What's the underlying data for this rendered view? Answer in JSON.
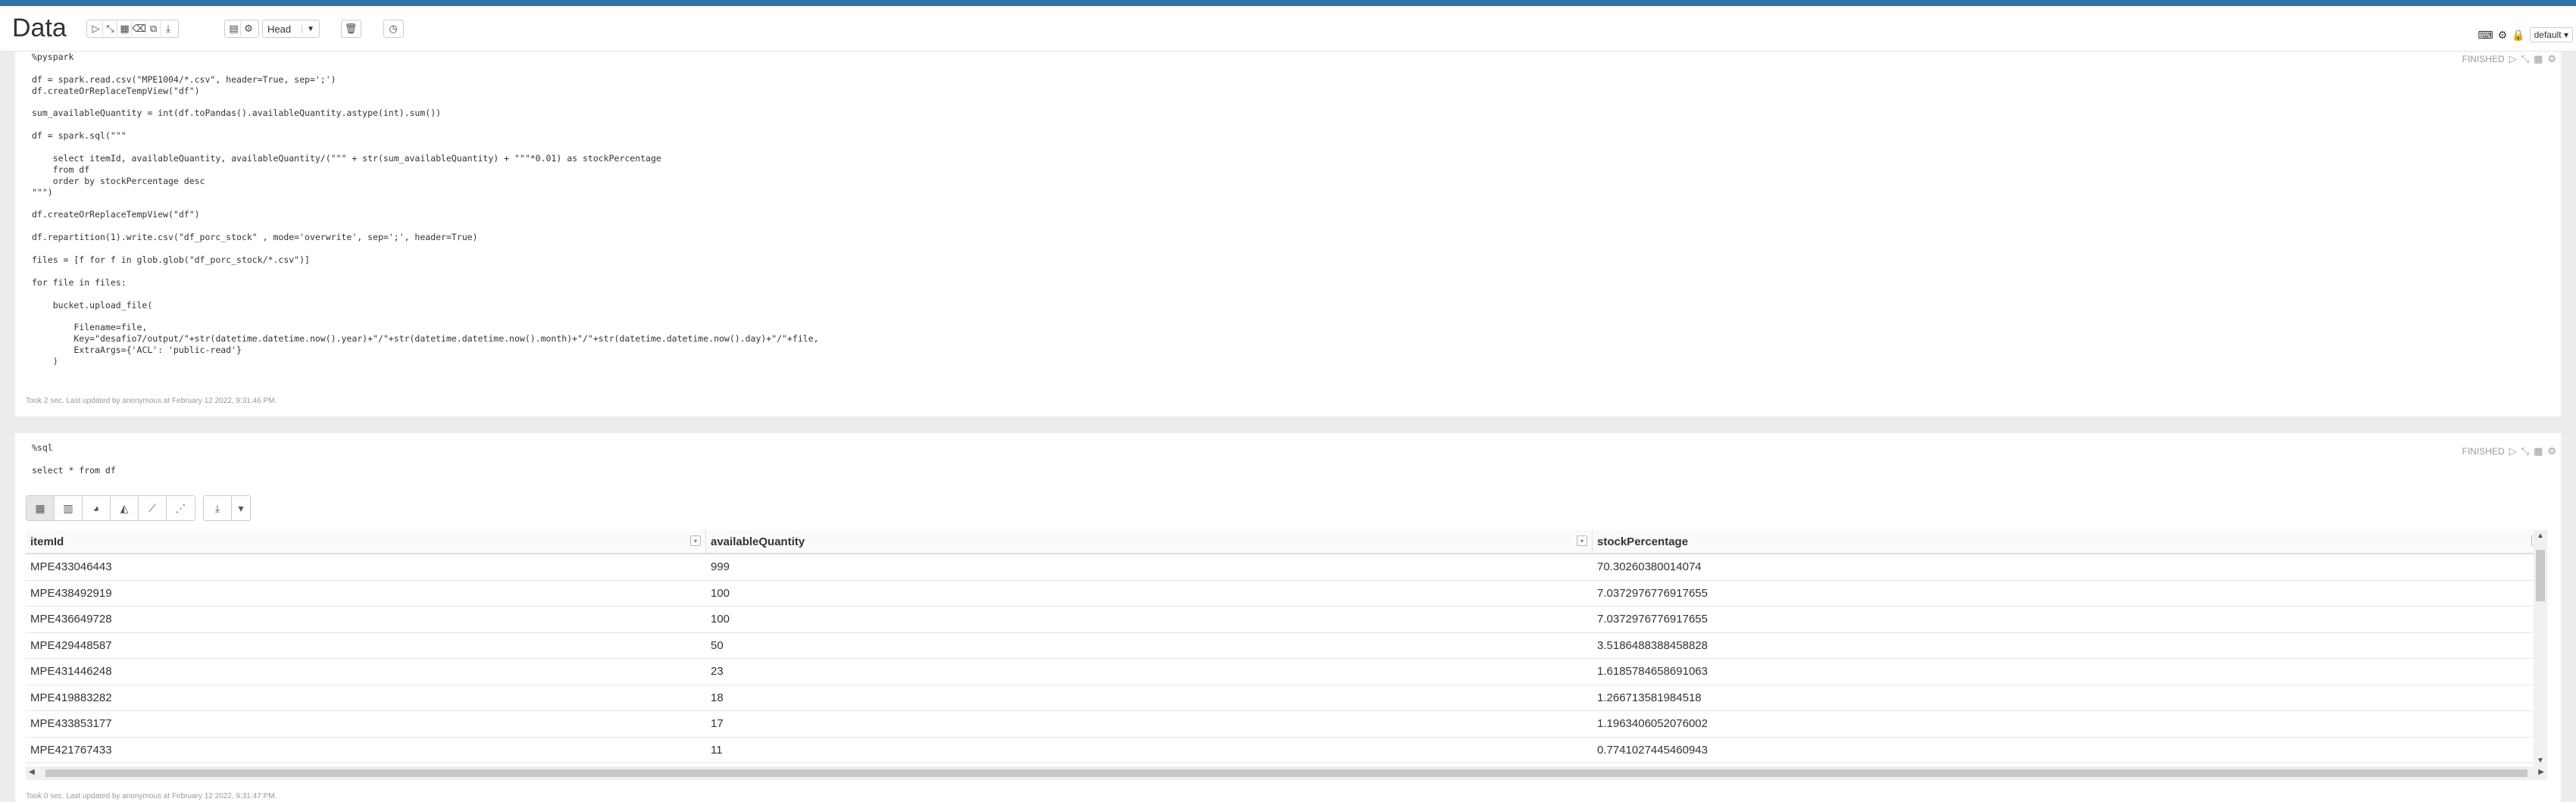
{
  "app": {
    "title": "Data",
    "head_label": "Head",
    "default_label": "default"
  },
  "paragraph1": {
    "status": "FINISHED",
    "code_lines": [
      "%pyspark",
      "",
      "df = spark.read.csv(\"MPE1004/*.csv\", header=True, sep=';')",
      "df.createOrReplaceTempView(\"df\")",
      "",
      "sum_availableQuantity = int(df.toPandas().availableQuantity.astype(int).sum())",
      "",
      "df = spark.sql(\"\"\"",
      "",
      "    select itemId, availableQuantity, availableQuantity/(\"\"\" + str(sum_availableQuantity) + \"\"\"*0.01) as stockPercentage",
      "    from df",
      "    order by stockPercentage desc",
      "\"\"\")",
      "",
      "df.createOrReplaceTempView(\"df\")",
      "",
      "df.repartition(1).write.csv(\"df_porc_stock\" , mode='overwrite', sep=';', header=True)",
      "",
      "files = [f for f in glob.glob(\"df_porc_stock/*.csv\")]",
      "",
      "for file in files:",
      "",
      "    bucket.upload_file(",
      "",
      "        Filename=file,",
      "        Key=\"desafio7/output/\"+str(datetime.datetime.now().year)+\"/\"+str(datetime.datetime.now().month)+\"/\"+str(datetime.datetime.now().day)+\"/\"+file,",
      "        ExtraArgs={'ACL': 'public-read'}",
      "    )"
    ],
    "footer": "Took 2 sec. Last updated by anonymous at February 12 2022, 9:31:46 PM."
  },
  "paragraph2": {
    "status": "FINISHED",
    "code_lines": [
      "%sql",
      "",
      "select * from df"
    ],
    "footer": "Took 0 sec. Last updated by anonymous at February 12 2022, 9:31:47 PM.",
    "table": {
      "columns": [
        "itemId",
        "availableQuantity",
        "stockPercentage"
      ],
      "rows": [
        [
          "MPE433046443",
          "999",
          "70.30260380014074"
        ],
        [
          "MPE438492919",
          "100",
          "7.0372976776917655"
        ],
        [
          "MPE436649728",
          "100",
          "7.0372976776917655"
        ],
        [
          "MPE429448587",
          "50",
          "3.5186488388458828"
        ],
        [
          "MPE431446248",
          "23",
          "1.6185784658691063"
        ],
        [
          "MPE419883282",
          "18",
          "1.266713581984518"
        ],
        [
          "MPE433853177",
          "17",
          "1.1963406052076002"
        ],
        [
          "MPE421767433",
          "11",
          "0.7741027445460943"
        ]
      ]
    }
  },
  "icons": {
    "toolbar_run": "play-icon",
    "toolbar_expand": "expand-icon",
    "toolbar_table": "table-icon",
    "toolbar_clear": "eraser-icon",
    "toolbar_copy": "copy-icon",
    "toolbar_export": "download-icon",
    "toolbar_file": "file-icon",
    "toolbar_settings": "gear-icon",
    "toolbar_delete": "trash-icon",
    "toolbar_clock": "clock-icon",
    "keyboard": "keyboard-icon",
    "lock": "lock-icon"
  }
}
